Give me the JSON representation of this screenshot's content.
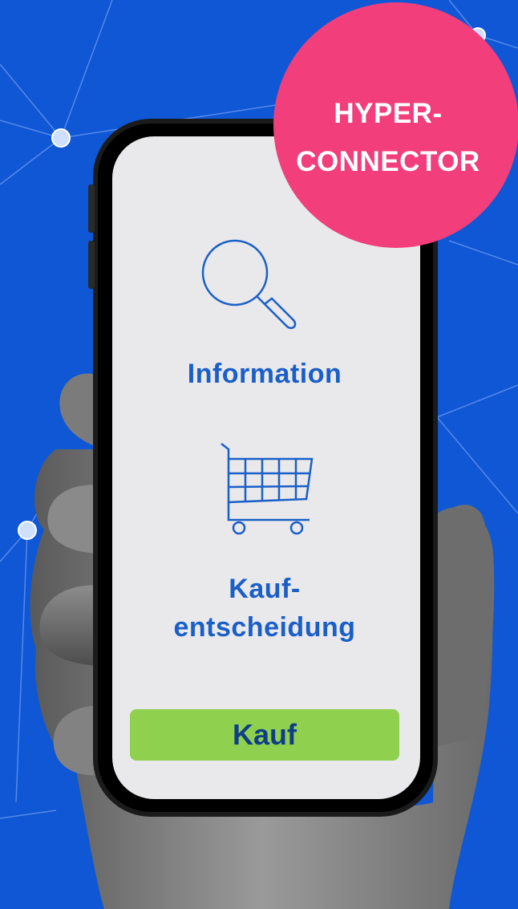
{
  "badge": {
    "line1": "HYPER-",
    "line2": "CONNECTOR",
    "color": "#f23f7c"
  },
  "phone": {
    "search_label": "Information",
    "purchase_label_line1": "Kauf-",
    "purchase_label_line2": "entscheidung",
    "buy_button_label": "Kauf",
    "icons": [
      "magnifier-icon",
      "shopping-cart-icon"
    ]
  },
  "colors": {
    "background": "#0f57d4",
    "accent_text": "#1a5fc8",
    "button": "#8fd14f",
    "badge": "#f23f7c"
  }
}
